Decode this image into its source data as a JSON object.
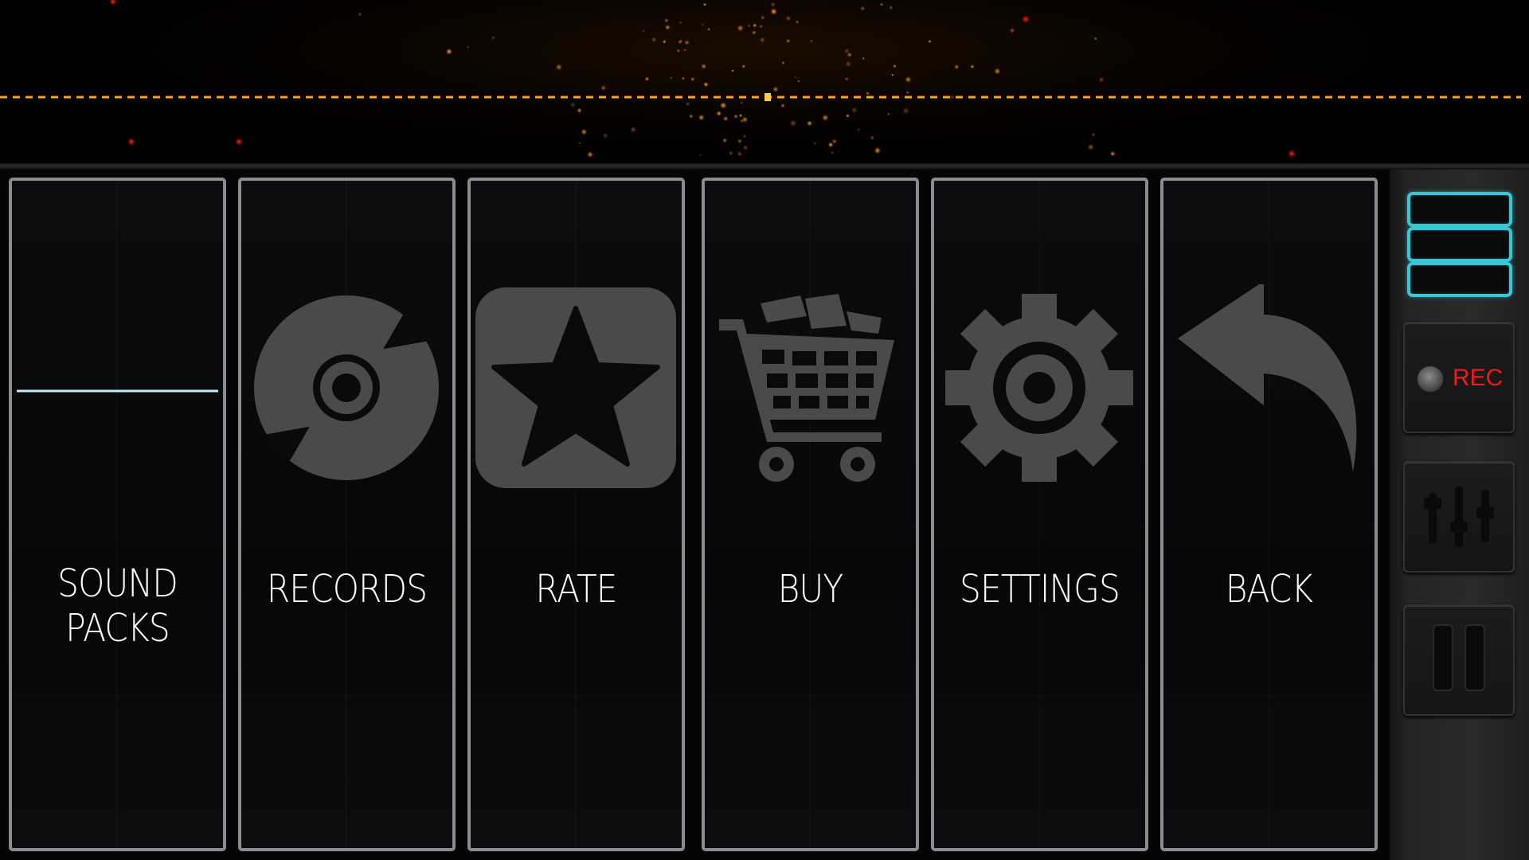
{
  "colors": {
    "tile_border": "#8a8c92",
    "icon_gray": "#4a4a4a",
    "waveform_cyan": "#3fd0ff",
    "visualizer_orange": "#ff9c1a",
    "rec_red": "#ee1b1b",
    "side_accent_cyan": "#38c7d6"
  },
  "menu": {
    "items": [
      {
        "id": "sound-packs",
        "label_line1": "SOUND",
        "label_line2": "PACKS",
        "icon": "waveform-icon"
      },
      {
        "id": "records",
        "label": "RECORDS",
        "icon": "vinyl-disc-icon"
      },
      {
        "id": "rate",
        "label": "RATE",
        "icon": "star-icon"
      },
      {
        "id": "buy",
        "label": "BUY",
        "icon": "shopping-cart-icon"
      },
      {
        "id": "settings",
        "label": "SETTINGS",
        "icon": "gear-icon"
      },
      {
        "id": "back",
        "label": "BACK",
        "icon": "back-arrow-icon"
      }
    ]
  },
  "side_panel": {
    "menu_icon": "hamburger-menu-icon",
    "rec_label": "REC",
    "mixer_icon": "mixer-sliders-icon",
    "pause_icon": "pause-icon"
  }
}
